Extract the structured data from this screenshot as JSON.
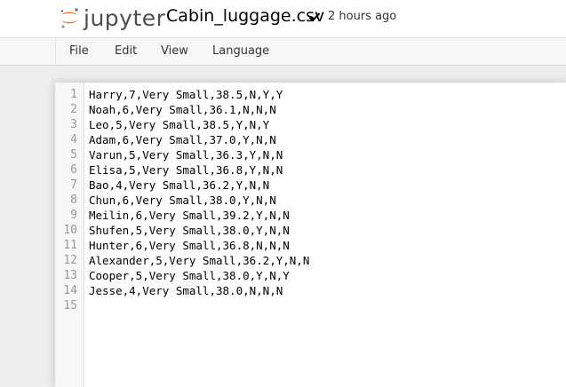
{
  "header": {
    "logo_text": "jupyter",
    "document_title": "Cabin_luggage.csv",
    "save_status": "2 hours ago"
  },
  "menu": {
    "items": [
      "File",
      "Edit",
      "View",
      "Language"
    ]
  },
  "editor": {
    "line_numbers": [
      "1",
      "2",
      "3",
      "4",
      "5",
      "6",
      "7",
      "8",
      "9",
      "10",
      "11",
      "12",
      "13",
      "14",
      "15"
    ],
    "lines": [
      "Harry,7,Very Small,38.5,N,Y,Y",
      "Noah,6,Very Small,36.1,N,N,N",
      "Leo,5,Very Small,38.5,Y,N,Y",
      "Adam,6,Very Small,37.0,Y,N,N",
      "Varun,5,Very Small,36.3,Y,N,N",
      "Elisa,5,Very Small,36.8,Y,N,N",
      "Bao,4,Very Small,36.2,Y,N,N",
      "Chun,6,Very Small,38.0,Y,N,N",
      "Meilin,6,Very Small,39.2,Y,N,N",
      "Shufen,5,Very Small,38.0,Y,N,N",
      "Hunter,6,Very Small,36.8,N,N,N",
      "Alexander,5,Very Small,36.2,Y,N,N",
      "Cooper,5,Very Small,38.0,Y,N,Y",
      "Jesse,4,Very Small,38.0,N,N,N",
      ""
    ]
  },
  "colors": {
    "logo_orange": "#f37726",
    "logo_gray": "#767677"
  },
  "icons": {
    "logo": "jupyter-logo-icon",
    "saved": "checkmark-icon"
  }
}
